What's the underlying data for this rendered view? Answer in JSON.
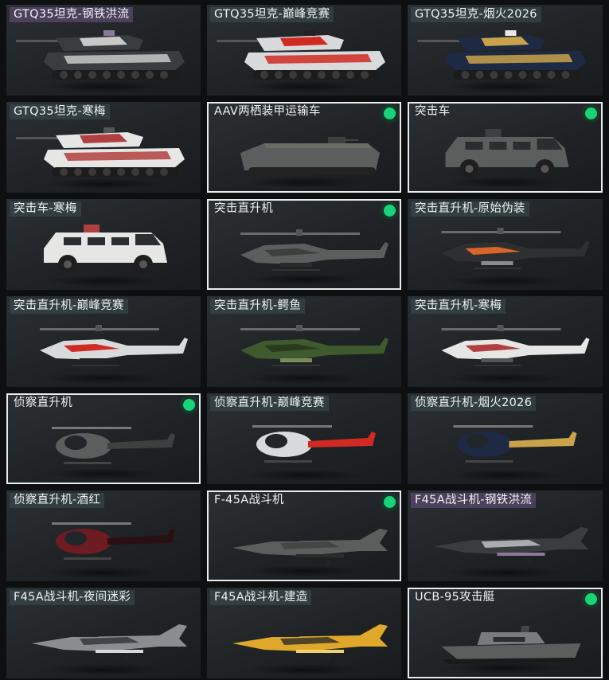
{
  "items": [
    {
      "title": "GTQ35坦克-钢铁洪流",
      "type": "tank",
      "icon": "tank-icon",
      "skin": "steel",
      "selected": false,
      "equipped": false,
      "label_style": "purple"
    },
    {
      "title": "GTQ35坦克-巅峰竞赛",
      "type": "tank",
      "icon": "tank-icon",
      "skin": "race",
      "selected": false,
      "equipped": false,
      "label_style": "teal"
    },
    {
      "title": "GTQ35坦克-烟火2026",
      "type": "tank",
      "icon": "tank-icon",
      "skin": "firework",
      "selected": false,
      "equipped": false,
      "label_style": "teal"
    },
    {
      "title": "GTQ35坦克-寒梅",
      "type": "tank",
      "icon": "tank-icon",
      "skin": "plum",
      "selected": false,
      "equipped": false,
      "label_style": "teal"
    },
    {
      "title": "AAV两栖装甲运输车",
      "type": "aav",
      "icon": "amphibious-vehicle-icon",
      "skin": "default",
      "selected": true,
      "equipped": true,
      "label_style": "plain"
    },
    {
      "title": "突击车",
      "type": "apc",
      "icon": "assault-vehicle-icon",
      "skin": "default",
      "selected": true,
      "equipped": true,
      "label_style": "plain"
    },
    {
      "title": "突击车-寒梅",
      "type": "apc",
      "icon": "assault-vehicle-icon",
      "skin": "plum",
      "selected": false,
      "equipped": false,
      "label_style": "teal"
    },
    {
      "title": "突击直升机",
      "type": "attack_heli",
      "icon": "attack-helicopter-icon",
      "skin": "default",
      "selected": true,
      "equipped": true,
      "label_style": "plain"
    },
    {
      "title": "突击直升机-原始伪装",
      "type": "attack_heli",
      "icon": "attack-helicopter-icon",
      "skin": "primal",
      "selected": false,
      "equipped": false,
      "label_style": "teal"
    },
    {
      "title": "突击直升机-巅峰竞赛",
      "type": "attack_heli",
      "icon": "attack-helicopter-icon",
      "skin": "race",
      "selected": false,
      "equipped": false,
      "label_style": "teal"
    },
    {
      "title": "突击直升机-鳄鱼",
      "type": "attack_heli",
      "icon": "attack-helicopter-icon",
      "skin": "croc",
      "selected": false,
      "equipped": false,
      "label_style": "teal"
    },
    {
      "title": "突击直升机-寒梅",
      "type": "attack_heli",
      "icon": "attack-helicopter-icon",
      "skin": "plum",
      "selected": false,
      "equipped": false,
      "label_style": "teal"
    },
    {
      "title": "侦察直升机",
      "type": "scout_heli",
      "icon": "scout-helicopter-icon",
      "skin": "default",
      "selected": true,
      "equipped": true,
      "label_style": "plain"
    },
    {
      "title": "侦察直升机-巅峰竞赛",
      "type": "scout_heli",
      "icon": "scout-helicopter-icon",
      "skin": "race",
      "selected": false,
      "equipped": false,
      "label_style": "teal"
    },
    {
      "title": "侦察直升机-烟火2026",
      "type": "scout_heli",
      "icon": "scout-helicopter-icon",
      "skin": "firework",
      "selected": false,
      "equipped": false,
      "label_style": "teal"
    },
    {
      "title": "侦察直升机-酒红",
      "type": "scout_heli",
      "icon": "scout-helicopter-icon",
      "skin": "wine",
      "selected": false,
      "equipped": false,
      "label_style": "teal"
    },
    {
      "title": "F-45A战斗机",
      "type": "jet",
      "icon": "fighter-jet-icon",
      "skin": "default",
      "selected": true,
      "equipped": true,
      "label_style": "plain"
    },
    {
      "title": "F45A战斗机-钢铁洪流",
      "type": "jet",
      "icon": "fighter-jet-icon",
      "skin": "steel",
      "selected": false,
      "equipped": false,
      "label_style": "purple"
    },
    {
      "title": "F45A战斗机-夜间迷彩",
      "type": "jet",
      "icon": "fighter-jet-icon",
      "skin": "nightcamo",
      "selected": false,
      "equipped": false,
      "label_style": "teal"
    },
    {
      "title": "F45A战斗机-建造",
      "type": "jet",
      "icon": "fighter-jet-icon",
      "skin": "build",
      "selected": false,
      "equipped": false,
      "label_style": "teal"
    },
    {
      "title": "UCB-95攻击艇",
      "type": "boat",
      "icon": "attack-boat-icon",
      "skin": "default",
      "selected": true,
      "equipped": true,
      "label_style": "plain"
    }
  ],
  "skins": {
    "steel": {
      "body": "#3a3d40",
      "accent": "#c8c8c8",
      "detail": "#8a7a9a"
    },
    "race": {
      "body": "#d8dadc",
      "accent": "#d12a22",
      "detail": "#222222"
    },
    "firework": {
      "body": "#1e2a44",
      "accent": "#c9a24a",
      "detail": "#e8e8e8"
    },
    "plum": {
      "body": "#e6e6e4",
      "accent": "#b04040",
      "detail": "#555555"
    },
    "default": {
      "body": "#5a5e5c",
      "accent": "#3c403e",
      "detail": "#2a2c2c"
    },
    "primal": {
      "body": "#2d2f30",
      "accent": "#d8652a",
      "detail": "#8a8a8a"
    },
    "croc": {
      "body": "#3f5a2e",
      "accent": "#2a3a1e",
      "detail": "#7a8a5a"
    },
    "wine": {
      "body": "#6e1c22",
      "accent": "#2a1012",
      "detail": "#bbbbbb"
    },
    "nightcamo": {
      "body": "#8a8e92",
      "accent": "#2e3236",
      "detail": "#d8d8d8"
    },
    "build": {
      "body": "#e0a82a",
      "accent": "#2a2a2a",
      "detail": "#f0d070"
    }
  },
  "colors": {
    "equipped_indicator": "#1ad27a",
    "selected_border": "#e9ecec"
  }
}
